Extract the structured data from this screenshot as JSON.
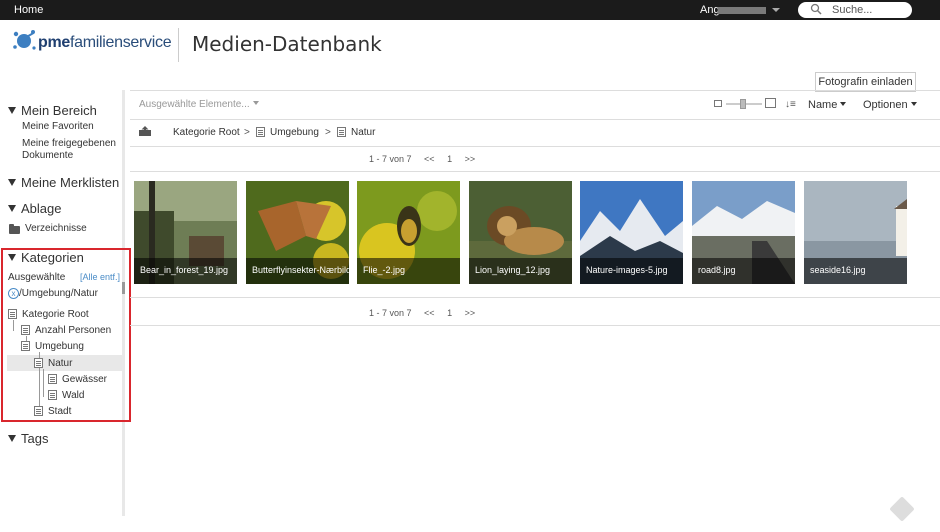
{
  "topbar": {
    "home": "Home",
    "user_prefix": "Ang",
    "search_placeholder": "Suche..."
  },
  "header": {
    "brand_bold": "pme",
    "brand_rest": "familienservice",
    "title": "Medien-Datenbank"
  },
  "upload_button": "Fotografin einladen",
  "sidebar": {
    "mein_bereich": "Mein Bereich",
    "favoriten": "Meine Favoriten",
    "freigegeben": "Meine freigegebenen Dokumente",
    "merklisten": "Meine Merklisten",
    "ablage": "Ablage",
    "verzeichnisse": "Verzeichnisse",
    "kategorien": "Kategorien",
    "ausgewaehlte": "Ausgewählte",
    "alle_entf": "[Alle entf.]",
    "selected_path": "/Umgebung/Natur",
    "tags": "Tags",
    "tree": [
      {
        "label": "Kategorie Root"
      },
      {
        "label": "Anzahl Personen"
      },
      {
        "label": "Umgebung"
      },
      {
        "label": "Natur",
        "selected": true
      },
      {
        "label": "Gewässer"
      },
      {
        "label": "Wald"
      },
      {
        "label": "Stadt"
      }
    ]
  },
  "toolbar": {
    "selected_elements": "Ausgewählte Elemente...",
    "sort_label": "Name",
    "options_label": "Optionen"
  },
  "breadcrumb": [
    "Kategorie Root",
    "Umgebung",
    "Natur"
  ],
  "pager": {
    "range": "1 - 7 von 7",
    "prev": "<<",
    "page": "1",
    "next": ">>"
  },
  "images": [
    {
      "name": "Bear_in_forest_19.jpg"
    },
    {
      "name": "Butterflyinsekter-Nærbilde"
    },
    {
      "name": "Flie_-2.jpg"
    },
    {
      "name": "Lion_laying_12.jpg"
    },
    {
      "name": "Nature-images-5.jpg"
    },
    {
      "name": "road8.jpg"
    },
    {
      "name": "seaside16.jpg"
    }
  ]
}
